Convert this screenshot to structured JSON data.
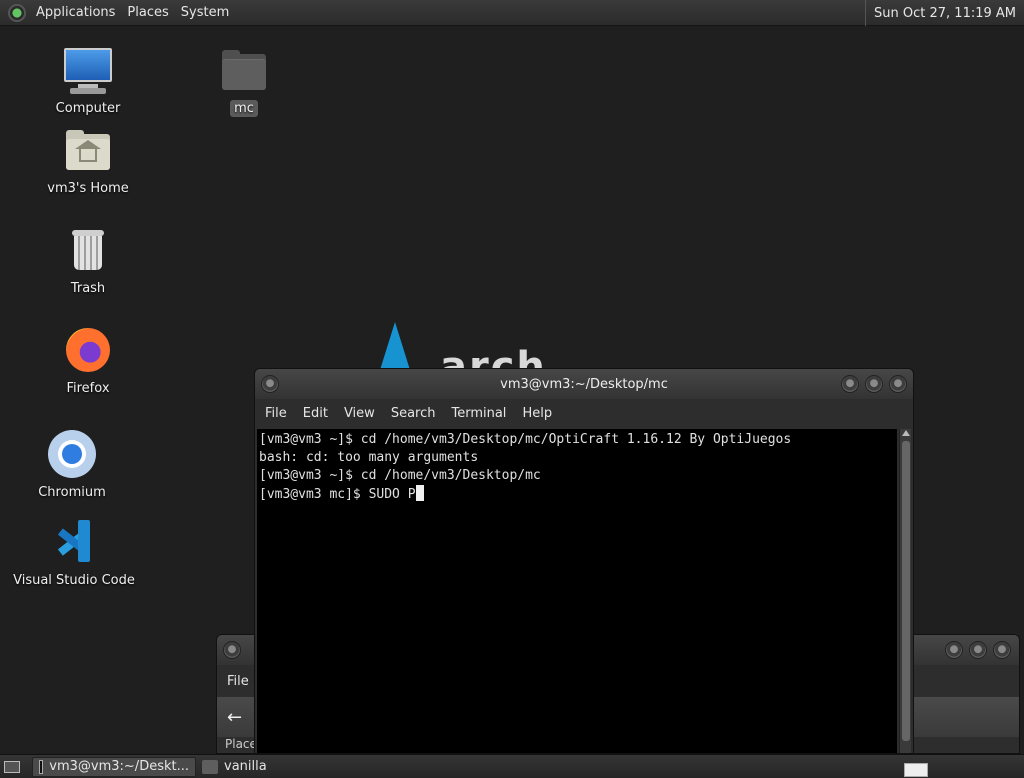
{
  "top_panel": {
    "menus": [
      "Applications",
      "Places",
      "System"
    ],
    "clock": "Sun Oct 27, 11:19 AM"
  },
  "desktop": {
    "icons": [
      {
        "label": "Computer",
        "icon": "computer-icon"
      },
      {
        "label": "mc",
        "icon": "folder-icon"
      },
      {
        "label": "vm3's Home",
        "icon": "home-folder-icon"
      },
      {
        "label": "Trash",
        "icon": "trash-icon"
      },
      {
        "label": "Firefox",
        "icon": "firefox-icon"
      },
      {
        "label": "Chromium",
        "icon": "chromium-icon"
      },
      {
        "label": "Visual Studio Code",
        "icon": "vscode-icon"
      }
    ],
    "wallpaper_text": "arch"
  },
  "terminal": {
    "title": "vm3@vm3:~/Desktop/mc",
    "menu": [
      "File",
      "Edit",
      "View",
      "Search",
      "Terminal",
      "Help"
    ],
    "lines": [
      "[vm3@vm3 ~]$ cd /home/vm3/Desktop/mc/OptiCraft 1.16.12 By OptiJuegos",
      "bash: cd: too many arguments",
      "[vm3@vm3 ~]$ cd /home/vm3/Desktop/mc",
      "[vm3@vm3 mc]$ SUDO P"
    ]
  },
  "file_manager": {
    "menu_file": "File",
    "places_label": "Place"
  },
  "taskbar": {
    "tasks": [
      {
        "label": "vm3@vm3:~/Deskt...",
        "icon": "terminal-icon",
        "active": true
      },
      {
        "label": "vanilla",
        "icon": "folder-icon",
        "active": false
      }
    ]
  },
  "colors": {
    "desktop_bg": "#1f1f1f",
    "arch_blue": "#1793d1",
    "terminal_bg": "#000000"
  }
}
